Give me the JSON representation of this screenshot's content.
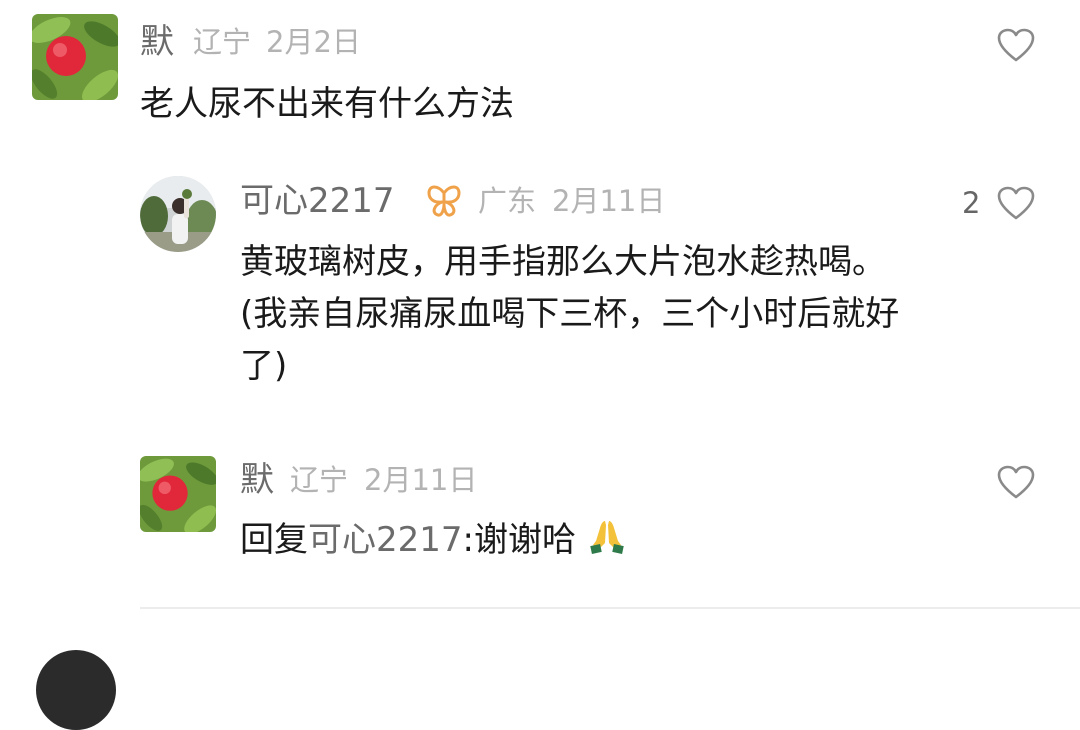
{
  "comments": [
    {
      "user": "默",
      "location": "辽宁",
      "date": "2月2日",
      "text": "老人尿不出来有什么方法",
      "avatar_icon": "peach-avatar",
      "like_count": ""
    },
    {
      "user": "可心2217",
      "location": "广东",
      "date": "2月11日",
      "text_line1": "黄玻璃树皮，用手指那么大片泡水趁热喝。",
      "text_line2": "(我亲自尿痛尿血喝下三杯，三个小时后就好",
      "text_line3": "了)",
      "avatar_icon": "person-avatar",
      "badge_icon": "butterfly-badge-icon",
      "like_count": "2"
    },
    {
      "user": "默",
      "location": "辽宁",
      "date": "2月11日",
      "reply_prefix": "回复",
      "reply_to": "可心2217",
      "reply_text": ":谢谢哈",
      "emoji_icon": "folded-hands-icon",
      "avatar_icon": "peach-avatar",
      "like_count": ""
    }
  ],
  "colors": {
    "username": "#6b6b6b",
    "meta": "#b3b3b3",
    "text": "#1a1a1a",
    "badge": "#f0a24a"
  }
}
